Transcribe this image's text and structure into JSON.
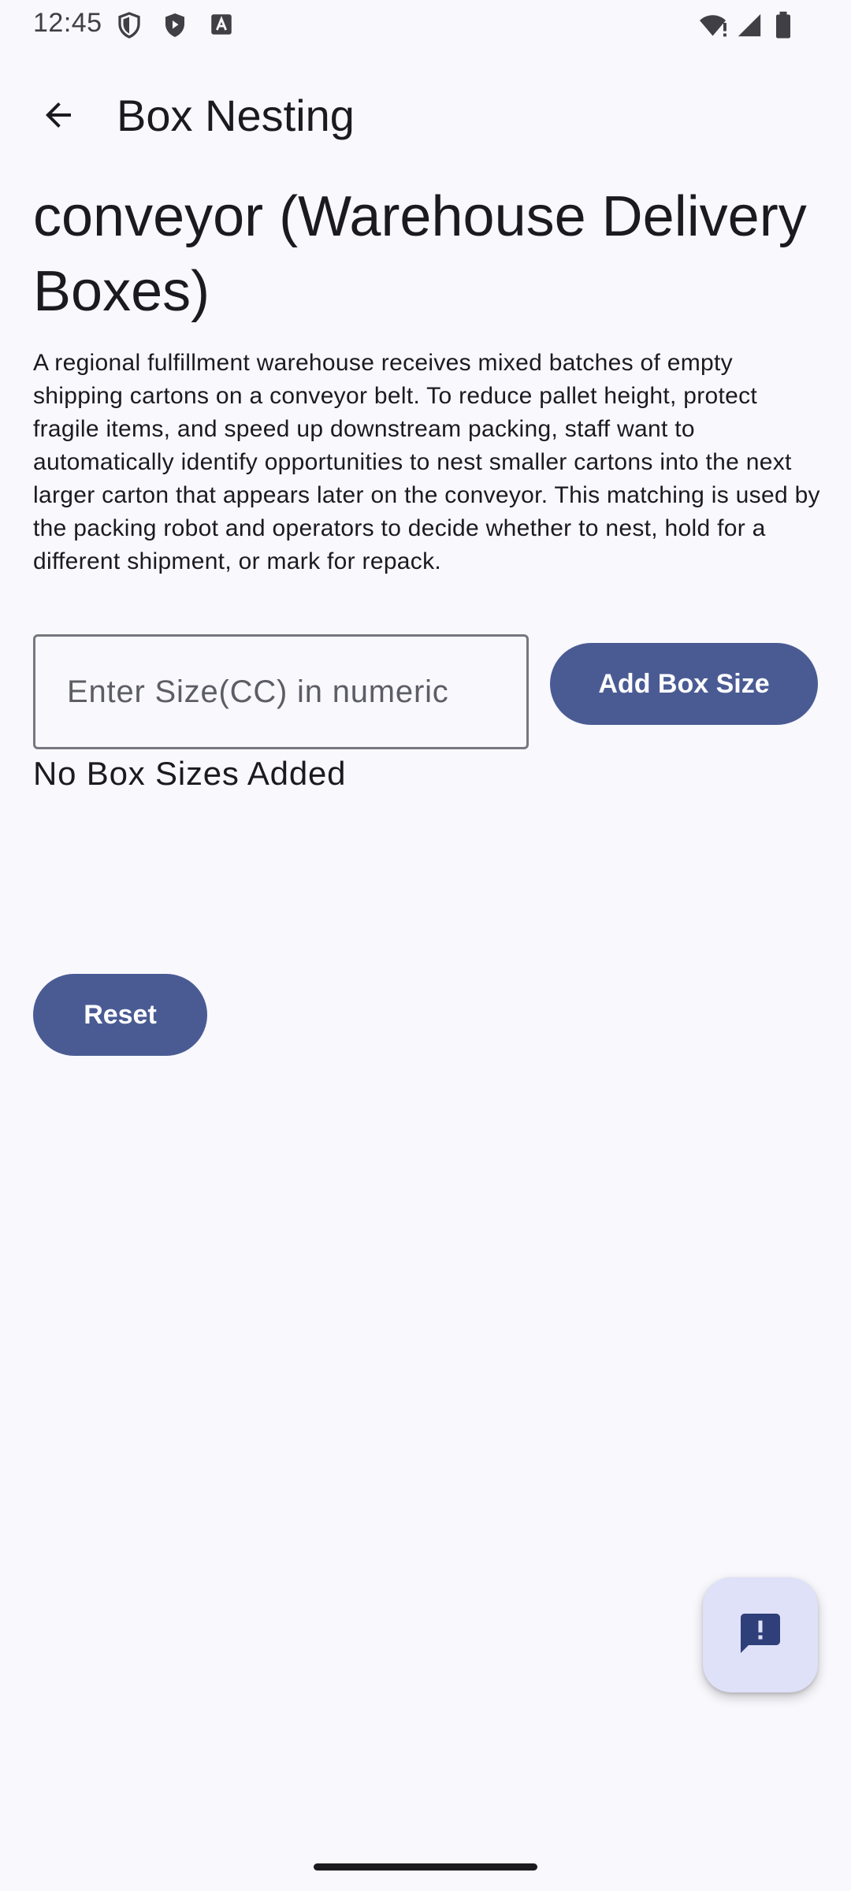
{
  "status_bar": {
    "time": "12:45",
    "icons": [
      "shield-outline-icon",
      "shield-play-icon",
      "font-a-icon",
      "wifi-alert-icon",
      "signal-icon",
      "battery-icon"
    ]
  },
  "app_bar": {
    "back_icon": "arrow-back-icon",
    "title": "Box Nesting"
  },
  "main": {
    "heading": "conveyor (Warehouse Delivery Boxes)",
    "description": "A regional fulfillment warehouse receives mixed batches of empty shipping cartons on a conveyor belt. To reduce pallet height, protect fragile items, and speed up downstream packing, staff want to automatically identify opportunities to nest smaller cartons into the next larger carton that appears later on the conveyor. This matching is used by the packing robot and operators to decide whether to nest, hold for a different shipment, or mark for repack.",
    "size_input": {
      "value": "",
      "placeholder": "Enter Size(CC) in numeric"
    },
    "add_button_label": "Add Box Size",
    "empty_message": "No Box Sizes Added",
    "reset_button_label": "Reset"
  },
  "fab": {
    "icon": "feedback-icon"
  },
  "colors": {
    "background": "#f8f8fd",
    "primary": "#4a5b94",
    "fab_container": "#dfe1f8",
    "on_surface": "#1b1b1f"
  }
}
